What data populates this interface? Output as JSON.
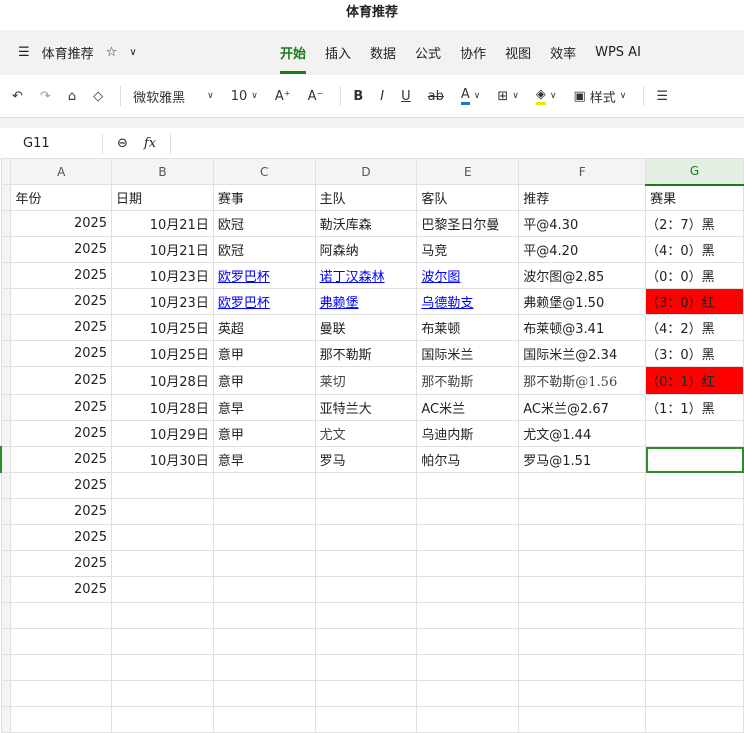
{
  "window_title": "体育推荐",
  "menubar": {
    "doc_name": "体育推荐",
    "tabs": [
      "开始",
      "插入",
      "数据",
      "公式",
      "协作",
      "视图",
      "效率",
      "WPS AI"
    ],
    "active_tab": "开始"
  },
  "toolbar": {
    "font": "微软雅黑",
    "size": "10",
    "style_label": "样式",
    "font_color": "#2b6fd6",
    "highlight_color": "#f2e600"
  },
  "formula_bar": {
    "cell_ref": "G11",
    "fx": "fx",
    "value": ""
  },
  "columns": [
    "A",
    "B",
    "C",
    "D",
    "E",
    "F",
    "G"
  ],
  "headers": [
    "年份",
    "日期",
    "赛事",
    "主队",
    "客队",
    "推荐",
    "赛果"
  ],
  "rows": [
    [
      "2025",
      "10月21日",
      "欧冠",
      "勒沃库森",
      "巴黎圣日尔曼",
      "平@4.30",
      "（2：7）黑"
    ],
    [
      "2025",
      "10月21日",
      "欧冠",
      "阿森纳",
      "马竞",
      "平@4.20",
      "（4：0）黑"
    ],
    [
      "2025",
      "10月23日",
      "欧罗巴杯",
      "诺丁汉森林",
      "波尔图",
      "波尔图@2.85",
      "（0：0）黑"
    ],
    [
      "2025",
      "10月23日",
      "欧罗巴杯",
      "弗赖堡",
      "乌德勒支",
      "弗赖堡@1.50",
      "（3：0）红"
    ],
    [
      "2025",
      "10月25日",
      "英超",
      "曼联",
      "布莱顿",
      "布莱顿@3.41",
      "（4：2）黑"
    ],
    [
      "2025",
      "10月25日",
      "意甲",
      "那不勒斯",
      "国际米兰",
      "国际米兰@2.34",
      "（3：0）黑"
    ],
    [
      "2025",
      "10月28日",
      "意甲",
      "莱切",
      "那不勒斯",
      "那不勒斯@1.56",
      "（0：1）红"
    ],
    [
      "2025",
      "10月28日",
      "意早",
      "亚特兰大",
      "AC米兰",
      "AC米兰@2.67",
      "（1：1）黑"
    ],
    [
      "2025",
      "10月29日",
      "意甲",
      "尤文",
      "乌迪内斯",
      "尤文@1.44",
      ""
    ],
    [
      "2025",
      "10月30日",
      "意早",
      "罗马",
      "帕尔马",
      "罗马@1.51",
      ""
    ],
    [
      "2025",
      "",
      "",
      "",
      "",
      "",
      ""
    ],
    [
      "2025",
      "",
      "",
      "",
      "",
      "",
      ""
    ],
    [
      "2025",
      "",
      "",
      "",
      "",
      "",
      ""
    ],
    [
      "2025",
      "",
      "",
      "",
      "",
      "",
      ""
    ],
    [
      "2025",
      "",
      "",
      "",
      "",
      "",
      ""
    ]
  ],
  "win_color": "#ff0000"
}
